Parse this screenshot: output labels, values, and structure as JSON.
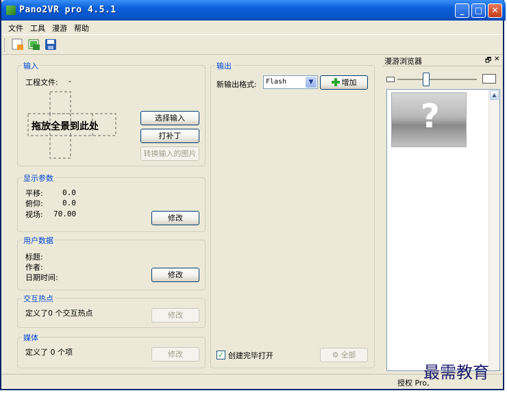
{
  "window": {
    "title": "Pano2VR pro 4.5.1"
  },
  "menu": [
    "文件",
    "工具",
    "漫游",
    "帮助"
  ],
  "toolbar": {
    "icons": [
      "new-project-icon",
      "open-project-icon",
      "save-project-icon"
    ]
  },
  "input_group": {
    "title": "输入",
    "project_file_label": "工程文件:",
    "project_file_value": "-",
    "drop_text": "拖放全景到此处",
    "select_input": "选择输入",
    "patch": "打补丁",
    "convert": "转换输入的图片"
  },
  "display_group": {
    "title": "显示参数",
    "pan_label": "平移:",
    "pan_value": "0.0",
    "tilt_label": "俯仰:",
    "tilt_value": "0.0",
    "fov_label": "视场:",
    "fov_value": "70.00",
    "modify": "修改"
  },
  "user_group": {
    "title": "用户数据",
    "title_label": "标题:",
    "author_label": "作者:",
    "datetime_label": "日期时间:",
    "modify": "修改"
  },
  "hotspot_group": {
    "title": "交互热点",
    "text": "定义了0 个交互热点",
    "modify": "修改"
  },
  "media_group": {
    "title": "媒体",
    "text": "定义了 0 个项",
    "modify": "修改"
  },
  "output_group": {
    "title": "输出",
    "new_format_label": "新输出格式:",
    "format_value": "Flash",
    "add": "增加",
    "open_after_label": "创建完毕打开",
    "all_button": "全部"
  },
  "browser_panel": {
    "title": "漫游浏览器",
    "float_glyph": "🗗",
    "close_glyph": "✕",
    "thumb_glyph": "?",
    "zoom_level": 0.35
  },
  "status": {
    "text": "授权 Pro, "
  },
  "watermark": "最需教育",
  "colors": {
    "title_blue": "#0a5fd8",
    "group_title": "#0046d5",
    "add_green": "#2da52d"
  }
}
